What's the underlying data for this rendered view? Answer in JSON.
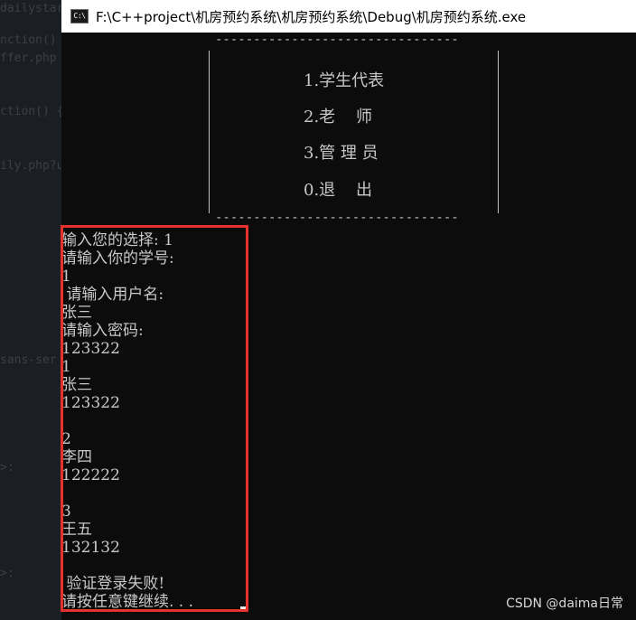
{
  "background_editor": {
    "lines": [
      "dailystar",
      "nction() {",
      "ffer.php",
      "ction() {",
      "",
      "ily.php?u",
      "sans-ser",
      ">:",
      ">:"
    ]
  },
  "window": {
    "icon": "C:\\",
    "title": "F:\\C++project\\机房预约系统\\机房预约系统\\Debug\\机房预约系统.exe"
  },
  "menu": {
    "border_top": "--------------------------------",
    "border_bottom": "--------------------------------",
    "items": [
      "1.学生代表",
      "2.老    师",
      "3.管 理 员",
      "0.退    出"
    ]
  },
  "console": {
    "lines": [
      "输入您的选择: 1",
      "请输入你的学号:",
      "1",
      " 请输入用户名:",
      "张三",
      "请输入密码:",
      "123322",
      "1",
      "张三",
      "123322",
      "",
      "2",
      "李四",
      "122222",
      "",
      "3",
      "王五",
      "132132",
      "",
      " 验证登录失败!",
      "请按任意键继续. . ."
    ]
  },
  "highlight_color": "#e8312c",
  "watermark": "CSDN @daima日常"
}
